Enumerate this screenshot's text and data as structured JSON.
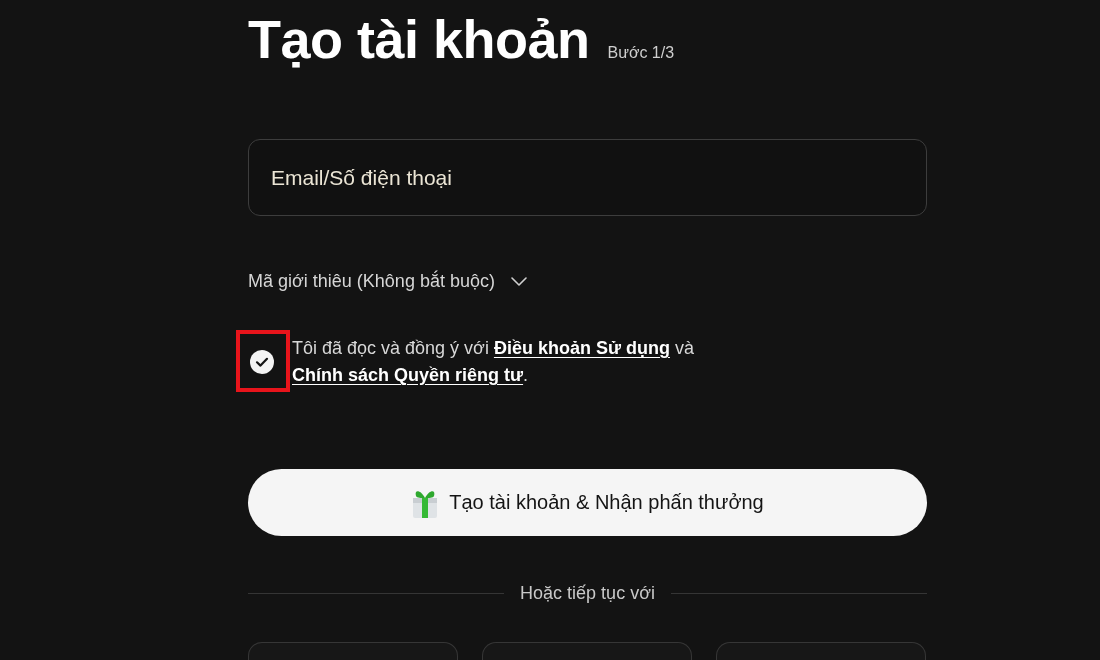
{
  "header": {
    "title": "Tạo tài khoản",
    "step": "Bước 1/3"
  },
  "email_field": {
    "placeholder": "Email/Số điện thoại"
  },
  "referral": {
    "label": "Mã giới thiêu (Không bắt buộc)",
    "expanded": false
  },
  "consent": {
    "checked": true,
    "highlighted": true,
    "text_before": "Tôi đã đọc và đồng ý với",
    "terms_link": "Điều khoản Sử dụng",
    "text_between": "và",
    "privacy_link": "Chính sách Quyền riêng tư",
    "text_after": "."
  },
  "primary_button": {
    "label": "Tạo tài khoản & Nhận phấn thưởng"
  },
  "divider": {
    "label": "Hoặc tiếp tục với"
  },
  "alternative_options": [
    {
      "kind": "button"
    },
    {
      "kind": "button"
    },
    {
      "kind": "button"
    }
  ]
}
